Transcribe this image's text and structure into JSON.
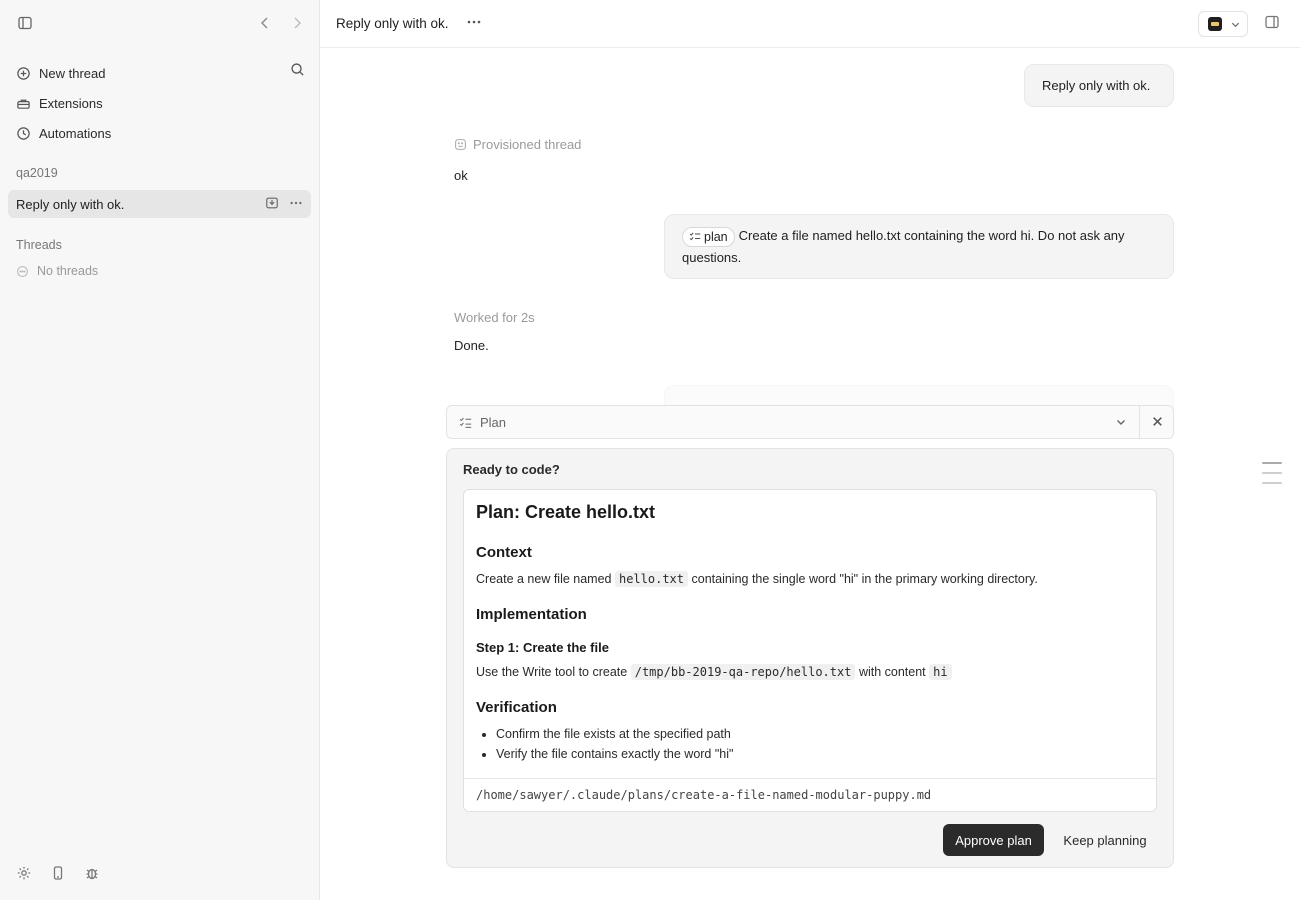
{
  "sidebar": {
    "nav": [
      {
        "label": "New thread",
        "icon": "plus-circle-icon"
      },
      {
        "label": "Extensions",
        "icon": "toolbox-icon"
      },
      {
        "label": "Automations",
        "icon": "clock-icon"
      }
    ],
    "project_title": "qa2019",
    "active_thread": "Reply only with ok.",
    "threads_title": "Threads",
    "empty_threads": "No threads"
  },
  "header": {
    "title": "Reply only with ok."
  },
  "chat": {
    "user_message_1": "Reply only with ok.",
    "provisioned_label": "Provisioned thread",
    "reply_1": "ok",
    "plan_chip_label": "plan",
    "user_message_2": "Create a file named hello.txt containing the word hi. Do not ask any questions.",
    "worked_label": "Worked for 2s",
    "reply_2": "Done."
  },
  "plan_bar": {
    "label": "Plan"
  },
  "plan_card": {
    "ready_label": "Ready to code?",
    "doc": {
      "title": "Plan: Create hello.txt",
      "context_heading": "Context",
      "context_pre": "Create a new file named",
      "context_code": "hello.txt",
      "context_post": "containing the single word \"hi\" in the primary working directory.",
      "impl_heading": "Implementation",
      "step_heading": "Step 1: Create the file",
      "step_pre": "Use the Write tool to create",
      "step_code": "/tmp/bb-2019-qa-repo/hello.txt",
      "step_mid": "with content",
      "step_code2": "hi",
      "verify_heading": "Verification",
      "verify_items": [
        "Confirm the file exists at the specified path",
        "Verify the file contains exactly the word \"hi\""
      ]
    },
    "file_path": "/home/sawyer/.claude/plans/create-a-file-named-modular-puppy.md",
    "approve_label": "Approve plan",
    "keep_label": "Keep planning"
  }
}
